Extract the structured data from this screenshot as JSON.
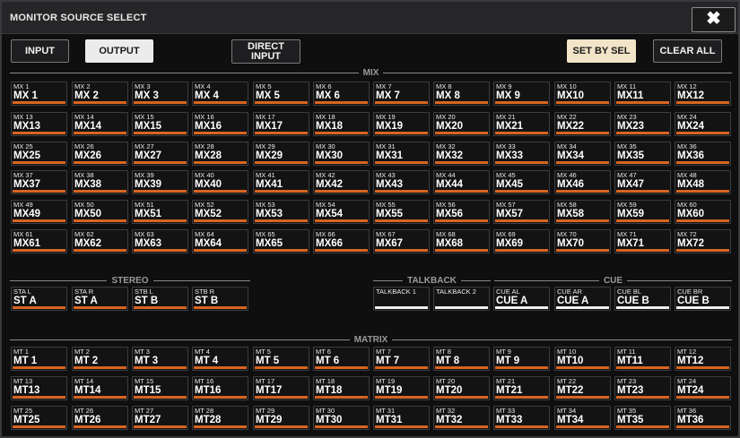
{
  "window": {
    "title": "MONITOR SOURCE SELECT",
    "close_label": "✖"
  },
  "toolbar": {
    "input_label": "INPUT",
    "output_label": "OUTPUT",
    "direct_input_label_1": "DIRECT",
    "direct_input_label_2": "INPUT",
    "set_by_sel_label": "SET BY SEL",
    "clear_all_label": "CLEAR ALL"
  },
  "sections": {
    "mix": "MIX",
    "stereo": "STEREO",
    "talkback": "TALKBACK",
    "cue": "CUE",
    "matrix": "MATRIX"
  },
  "mix": [
    {
      "small": "MX 1",
      "large": "MX 1"
    },
    {
      "small": "MX 2",
      "large": "MX 2"
    },
    {
      "small": "MX 3",
      "large": "MX 3"
    },
    {
      "small": "MX 4",
      "large": "MX 4"
    },
    {
      "small": "MX 5",
      "large": "MX 5"
    },
    {
      "small": "MX 6",
      "large": "MX 6"
    },
    {
      "small": "MX 7",
      "large": "MX 7"
    },
    {
      "small": "MX 8",
      "large": "MX 8"
    },
    {
      "small": "MX 9",
      "large": "MX 9"
    },
    {
      "small": "MX 10",
      "large": "MX10"
    },
    {
      "small": "MX 11",
      "large": "MX11"
    },
    {
      "small": "MX 12",
      "large": "MX12"
    },
    {
      "small": "MX 13",
      "large": "MX13"
    },
    {
      "small": "MX 14",
      "large": "MX14"
    },
    {
      "small": "MX 15",
      "large": "MX15"
    },
    {
      "small": "MX 16",
      "large": "MX16"
    },
    {
      "small": "MX 17",
      "large": "MX17"
    },
    {
      "small": "MX 18",
      "large": "MX18"
    },
    {
      "small": "MX 19",
      "large": "MX19"
    },
    {
      "small": "MX 20",
      "large": "MX20"
    },
    {
      "small": "MX 21",
      "large": "MX21"
    },
    {
      "small": "MX 22",
      "large": "MX22"
    },
    {
      "small": "MX 23",
      "large": "MX23"
    },
    {
      "small": "MX 24",
      "large": "MX24"
    },
    {
      "small": "MX 25",
      "large": "MX25"
    },
    {
      "small": "MX 26",
      "large": "MX26"
    },
    {
      "small": "MX 27",
      "large": "MX27"
    },
    {
      "small": "MX 28",
      "large": "MX28"
    },
    {
      "small": "MX 29",
      "large": "MX29"
    },
    {
      "small": "MX 30",
      "large": "MX30"
    },
    {
      "small": "MX 31",
      "large": "MX31"
    },
    {
      "small": "MX 32",
      "large": "MX32"
    },
    {
      "small": "MX 33",
      "large": "MX33"
    },
    {
      "small": "MX 34",
      "large": "MX34"
    },
    {
      "small": "MX 35",
      "large": "MX35"
    },
    {
      "small": "MX 36",
      "large": "MX36"
    },
    {
      "small": "MX 37",
      "large": "MX37"
    },
    {
      "small": "MX 38",
      "large": "MX38"
    },
    {
      "small": "MX 39",
      "large": "MX39"
    },
    {
      "small": "MX 40",
      "large": "MX40"
    },
    {
      "small": "MX 41",
      "large": "MX41"
    },
    {
      "small": "MX 42",
      "large": "MX42"
    },
    {
      "small": "MX 43",
      "large": "MX43"
    },
    {
      "small": "MX 44",
      "large": "MX44"
    },
    {
      "small": "MX 45",
      "large": "MX45"
    },
    {
      "small": "MX 46",
      "large": "MX46"
    },
    {
      "small": "MX 47",
      "large": "MX47"
    },
    {
      "small": "MX 48",
      "large": "MX48"
    },
    {
      "small": "MX 49",
      "large": "MX49"
    },
    {
      "small": "MX 50",
      "large": "MX50"
    },
    {
      "small": "MX 51",
      "large": "MX51"
    },
    {
      "small": "MX 52",
      "large": "MX52"
    },
    {
      "small": "MX 53",
      "large": "MX53"
    },
    {
      "small": "MX 54",
      "large": "MX54"
    },
    {
      "small": "MX 55",
      "large": "MX55"
    },
    {
      "small": "MX 56",
      "large": "MX56"
    },
    {
      "small": "MX 57",
      "large": "MX57"
    },
    {
      "small": "MX 58",
      "large": "MX58"
    },
    {
      "small": "MX 59",
      "large": "MX59"
    },
    {
      "small": "MX 60",
      "large": "MX60"
    },
    {
      "small": "MX 61",
      "large": "MX61"
    },
    {
      "small": "MX 62",
      "large": "MX62"
    },
    {
      "small": "MX 63",
      "large": "MX63"
    },
    {
      "small": "MX 64",
      "large": "MX64"
    },
    {
      "small": "MX 65",
      "large": "MX65"
    },
    {
      "small": "MX 66",
      "large": "MX66"
    },
    {
      "small": "MX 67",
      "large": "MX67"
    },
    {
      "small": "MX 68",
      "large": "MX68"
    },
    {
      "small": "MX 69",
      "large": "MX69"
    },
    {
      "small": "MX 70",
      "large": "MX70"
    },
    {
      "small": "MX 71",
      "large": "MX71"
    },
    {
      "small": "MX 72",
      "large": "MX72"
    }
  ],
  "stereo": [
    {
      "small": "STA L",
      "large": "ST A"
    },
    {
      "small": "STA R",
      "large": "ST A"
    },
    {
      "small": "STB L",
      "large": "ST B"
    },
    {
      "small": "STB R",
      "large": "ST B"
    }
  ],
  "talkback": [
    {
      "small": "TALKBACK 1",
      "large": ""
    },
    {
      "small": "TALKBACK 2",
      "large": ""
    }
  ],
  "cue": [
    {
      "small": "CUE AL",
      "large": "CUE A"
    },
    {
      "small": "CUE AR",
      "large": "CUE A"
    },
    {
      "small": "CUE BL",
      "large": "CUE B"
    },
    {
      "small": "CUE BR",
      "large": "CUE B"
    }
  ],
  "matrix": [
    {
      "small": "MT 1",
      "large": "MT 1"
    },
    {
      "small": "MT 2",
      "large": "MT 2"
    },
    {
      "small": "MT 3",
      "large": "MT 3"
    },
    {
      "small": "MT 4",
      "large": "MT 4"
    },
    {
      "small": "MT 5",
      "large": "MT 5"
    },
    {
      "small": "MT 6",
      "large": "MT 6"
    },
    {
      "small": "MT 7",
      "large": "MT 7"
    },
    {
      "small": "MT 8",
      "large": "MT 8"
    },
    {
      "small": "MT 9",
      "large": "MT 9"
    },
    {
      "small": "MT 10",
      "large": "MT10"
    },
    {
      "small": "MT 11",
      "large": "MT11"
    },
    {
      "small": "MT 12",
      "large": "MT12"
    },
    {
      "small": "MT 13",
      "large": "MT13"
    },
    {
      "small": "MT 14",
      "large": "MT14"
    },
    {
      "small": "MT 15",
      "large": "MT15"
    },
    {
      "small": "MT 16",
      "large": "MT16"
    },
    {
      "small": "MT 17",
      "large": "MT17"
    },
    {
      "small": "MT 18",
      "large": "MT18"
    },
    {
      "small": "MT 19",
      "large": "MT19"
    },
    {
      "small": "MT 20",
      "large": "MT20"
    },
    {
      "small": "MT 21",
      "large": "MT21"
    },
    {
      "small": "MT 22",
      "large": "MT22"
    },
    {
      "small": "MT 23",
      "large": "MT23"
    },
    {
      "small": "MT 24",
      "large": "MT24"
    },
    {
      "small": "MT 25",
      "large": "MT25"
    },
    {
      "small": "MT 26",
      "large": "MT26"
    },
    {
      "small": "MT 27",
      "large": "MT27"
    },
    {
      "small": "MT 28",
      "large": "MT28"
    },
    {
      "small": "MT 29",
      "large": "MT29"
    },
    {
      "small": "MT 30",
      "large": "MT30"
    },
    {
      "small": "MT 31",
      "large": "MT31"
    },
    {
      "small": "MT 32",
      "large": "MT32"
    },
    {
      "small": "MT 33",
      "large": "MT33"
    },
    {
      "small": "MT 34",
      "large": "MT34"
    },
    {
      "small": "MT 35",
      "large": "MT35"
    },
    {
      "small": "MT 36",
      "large": "MT36"
    }
  ],
  "colors": {
    "accent_bar": "#d9651f",
    "cue_bar": "#f0f0f0",
    "set_by_sel": "#f2e4c8"
  }
}
